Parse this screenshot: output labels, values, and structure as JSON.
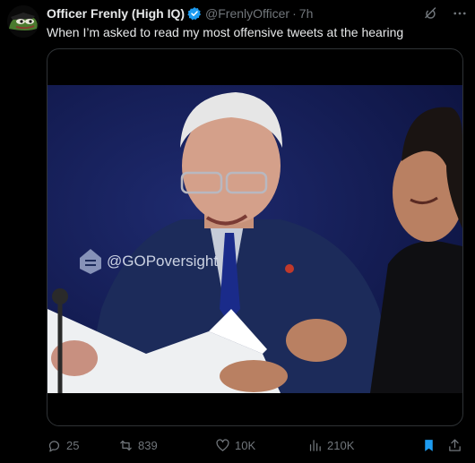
{
  "tweet": {
    "display_name": "Officer Frenly (High IQ)",
    "handle": "@FrenlyOfficer",
    "separator": "·",
    "time": "7h",
    "text": "When I’m asked to read my most offensive tweets at the hearing"
  },
  "media": {
    "watermark": "@GOPoversight"
  },
  "actions": {
    "replies": "25",
    "retweets": "839",
    "likes": "10K",
    "views": "210K"
  },
  "colors": {
    "background": "#000000",
    "text": "#e7e9ea",
    "muted": "#71767b",
    "verified": "#1d9bf0",
    "bookmark": "#1d9bf0",
    "border": "#2f3336"
  },
  "icons": [
    "avatar-pepe",
    "verified-badge-icon",
    "grok-icon",
    "more-icon",
    "reply-icon",
    "retweet-icon",
    "like-icon",
    "views-icon",
    "bookmark-icon",
    "share-icon"
  ]
}
